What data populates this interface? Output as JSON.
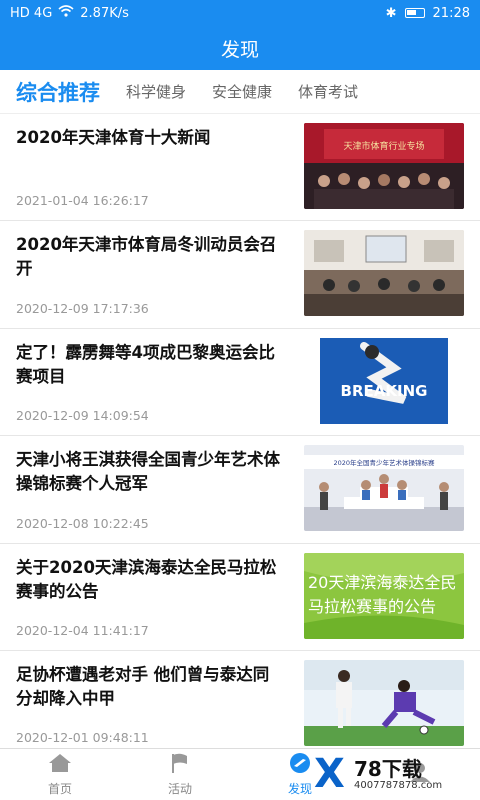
{
  "status": {
    "signal": "HD 4G",
    "speed": "2.87K/s",
    "time": "21:28"
  },
  "header": {
    "title": "发现"
  },
  "tabs": [
    {
      "label": "综合推荐",
      "active": true
    },
    {
      "label": "科学健身",
      "active": false
    },
    {
      "label": "安全健康",
      "active": false
    },
    {
      "label": "体育考试",
      "active": false
    }
  ],
  "news": [
    {
      "title": "2020年天津体育十大新闻",
      "time": "2021-01-04 16:26:17",
      "thumb_caption": "天津市体育行业专场"
    },
    {
      "title": "2020年天津市体育局冬训动员会召开",
      "time": "2020-12-09 17:17:36",
      "thumb_caption": ""
    },
    {
      "title": "定了！霹雳舞等4项成巴黎奥运会比赛项目",
      "time": "2020-12-09 14:09:54",
      "thumb_caption": "BREAKING"
    },
    {
      "title": "天津小将王淇获得全国青少年艺术体操锦标赛个人冠军",
      "time": "2020-12-08 10:22:45",
      "thumb_caption": "2020年全国青少年艺术体操锦标赛"
    },
    {
      "title": "关于2020天津滨海泰达全民马拉松赛事的公告",
      "time": "2020-12-04 11:41:17",
      "thumb_caption": "20天津滨海泰达全民马拉松赛事的公告"
    },
    {
      "title": "足协杯遭遇老对手 他们曾与泰达同分却降入中甲",
      "time": "2020-12-01 09:48:11",
      "thumb_caption": ""
    }
  ],
  "tabbar": [
    {
      "label": "首页",
      "icon": "home-icon",
      "active": false
    },
    {
      "label": "活动",
      "icon": "flag-icon",
      "active": false
    },
    {
      "label": "发现",
      "icon": "compass-icon",
      "active": true
    },
    {
      "label": "",
      "icon": "user-icon",
      "active": false
    }
  ],
  "watermark": {
    "name": "78下载",
    "url": "4007787878.com"
  },
  "colors": {
    "primary": "#1a8cf0"
  }
}
